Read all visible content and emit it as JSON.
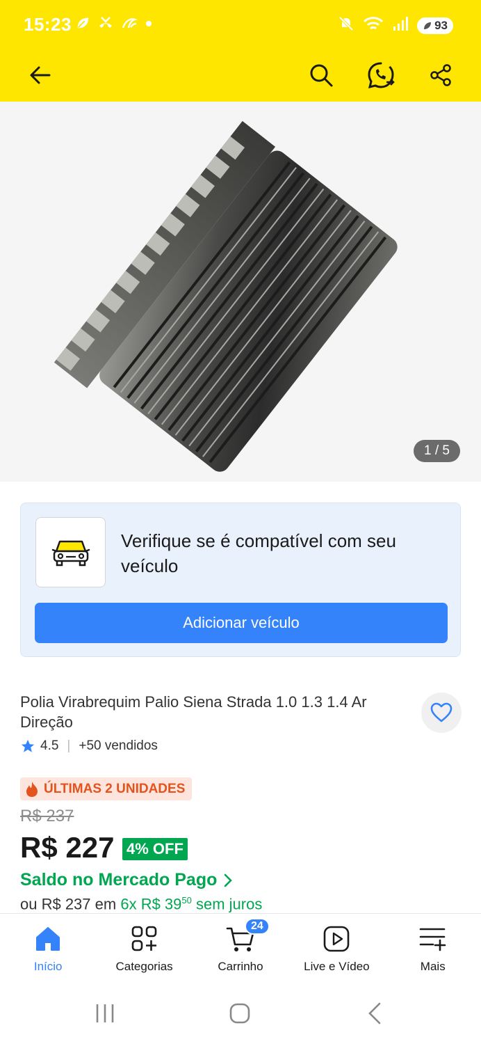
{
  "status_bar": {
    "time": "15:23",
    "battery": "93"
  },
  "colors": {
    "brand_yellow": "#fee600",
    "action_blue": "#3483fa",
    "success_green": "#00a650",
    "urgency_orange": "#e3531e"
  },
  "header": {
    "icons": [
      "back-arrow-icon",
      "search-icon",
      "whatsapp-icon",
      "share-icon"
    ]
  },
  "gallery": {
    "counter": "1 / 5"
  },
  "compatibility": {
    "title": "Verifique se é compatível com seu veículo",
    "button_label": "Adicionar veículo"
  },
  "product": {
    "title": "Polia Virabrequim Palio Siena Strada 1.0 1.3 1.4 Ar Direção",
    "rating": "4.5",
    "sold": "+50 vendidos",
    "badge": "ÚLTIMAS 2 UNIDADES",
    "old_price": "R$ 237",
    "price": "R$ 227",
    "discount": "4% OFF",
    "saldo": "Saldo no Mercado Pago",
    "installment_prefix": "ou R$ 237",
    "installment_mid": "em",
    "installment_value": "6x R$ 39",
    "installment_cents": "50",
    "installment_suffix": "sem juros"
  },
  "tabbar": {
    "items": [
      {
        "label": "Início",
        "icon": "home-icon"
      },
      {
        "label": "Categorias",
        "icon": "categories-icon"
      },
      {
        "label": "Carrinho",
        "icon": "cart-icon",
        "badge": "24"
      },
      {
        "label": "Live e Vídeo",
        "icon": "play-icon"
      },
      {
        "label": "Mais",
        "icon": "menu-plus-icon"
      }
    ]
  }
}
